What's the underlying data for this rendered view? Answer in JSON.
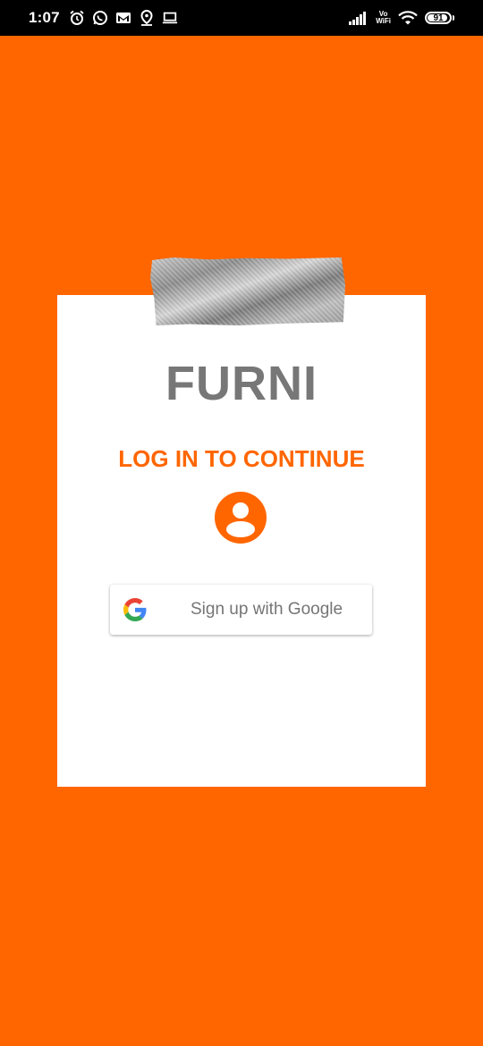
{
  "status_bar": {
    "time": "1:07",
    "vowifi_line1": "Vo",
    "vowifi_line2": "WiFi",
    "battery_level": "91",
    "icons": [
      "alarm-icon",
      "whatsapp-icon",
      "gmail-icon",
      "location-icon",
      "laptop-icon",
      "signal-icon",
      "wifi-icon",
      "battery-icon"
    ]
  },
  "login": {
    "app_name": "FURNI",
    "prompt": "LOG IN TO CONTINUE",
    "google_button_label": "Sign up with Google"
  },
  "colors": {
    "accent": "#ff6600",
    "card": "#ffffff",
    "brand_text": "#777777",
    "button_text": "#757575"
  }
}
